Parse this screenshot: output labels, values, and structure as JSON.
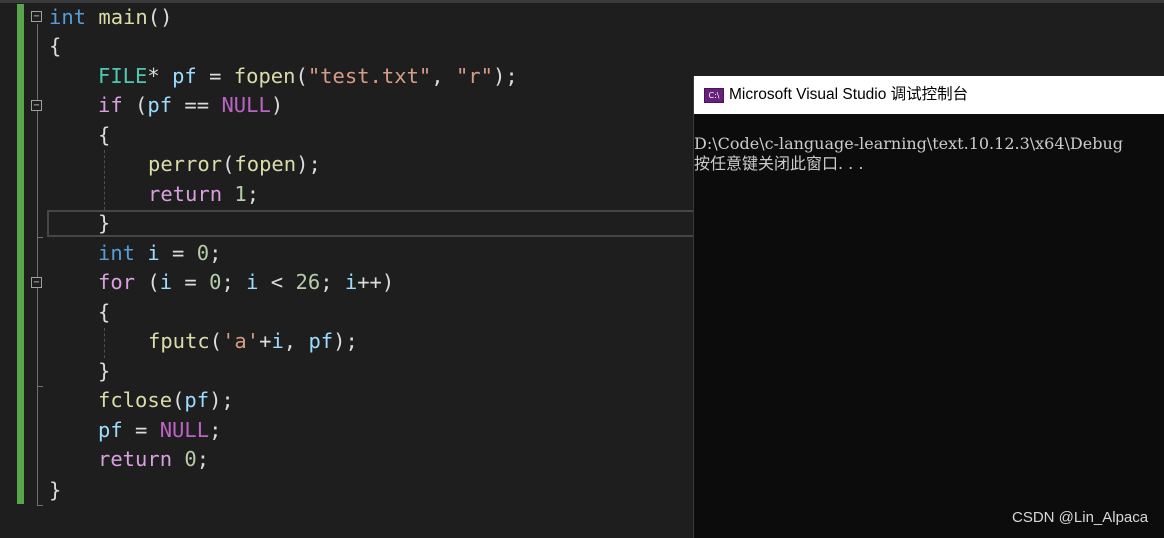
{
  "code": {
    "l1": {
      "kw": "int",
      "fn": "main",
      "tail": "()"
    },
    "l2": {
      "text": "{"
    },
    "l3": {
      "type": "FILE",
      "star": "* ",
      "var": "pf",
      "eq": " = ",
      "fn": "fopen",
      "open": "(",
      "s1": "\"test.txt\"",
      "comma": ", ",
      "s2": "\"r\"",
      "close": ");"
    },
    "l4": {
      "kw": "if",
      "p1": " (",
      "var": "pf",
      "op": " == ",
      "mac": "NULL",
      "p2": ")"
    },
    "l5": {
      "text": "{"
    },
    "l6": {
      "fn": "perror",
      "open": "(",
      "arg": "fopen",
      "close": ");"
    },
    "l7": {
      "kw": "return",
      "sp": " ",
      "num": "1",
      "semi": ";"
    },
    "l8": {
      "text": "}"
    },
    "l9": {
      "kw": "int",
      "sp": " ",
      "var": "i",
      "eq": " = ",
      "num": "0",
      "semi": ";"
    },
    "l10": {
      "kw": "for",
      "a": " (",
      "v1": "i",
      "b": " = ",
      "n1": "0",
      "c": "; ",
      "v2": "i",
      "d": " < ",
      "n2": "26",
      "e": "; ",
      "v3": "i",
      "f": "++)"
    },
    "l11": {
      "text": "{"
    },
    "l12": {
      "fn": "fputc",
      "open": "(",
      "str": "'a'",
      "plus": "+",
      "v1": "i",
      "comma": ", ",
      "v2": "pf",
      "close": ");"
    },
    "l13": {
      "text": "}"
    },
    "l14": {
      "fn": "fclose",
      "open": "(",
      "var": "pf",
      "close": ");"
    },
    "l15": {
      "var": "pf",
      "eq": " = ",
      "mac": "NULL",
      "semi": ";"
    },
    "l16": {
      "kw": "return",
      "sp": " ",
      "num": "0",
      "semi": ";"
    },
    "l17": {
      "text": "}"
    }
  },
  "console": {
    "title": "Microsoft Visual Studio 调试控制台",
    "icon_label": "C:\\",
    "line1": "D:\\Code\\c-language-learning\\text.10.12.3\\x64\\Debug",
    "line2": "按任意键关闭此窗口. . ."
  },
  "watermark": "CSDN @Lin_Alpaca",
  "colors": {
    "background": "#1e1e1e",
    "keyword": "#569cd6",
    "control_keyword": "#d8a0df",
    "type": "#4ec9b0",
    "function": "#dcdcaa",
    "variable": "#9cdcfe",
    "string": "#d69d85",
    "number": "#b5cea8",
    "macro": "#bd63c5",
    "changed_line_bar": "#57a64a",
    "console_background": "#0c0c0c"
  }
}
